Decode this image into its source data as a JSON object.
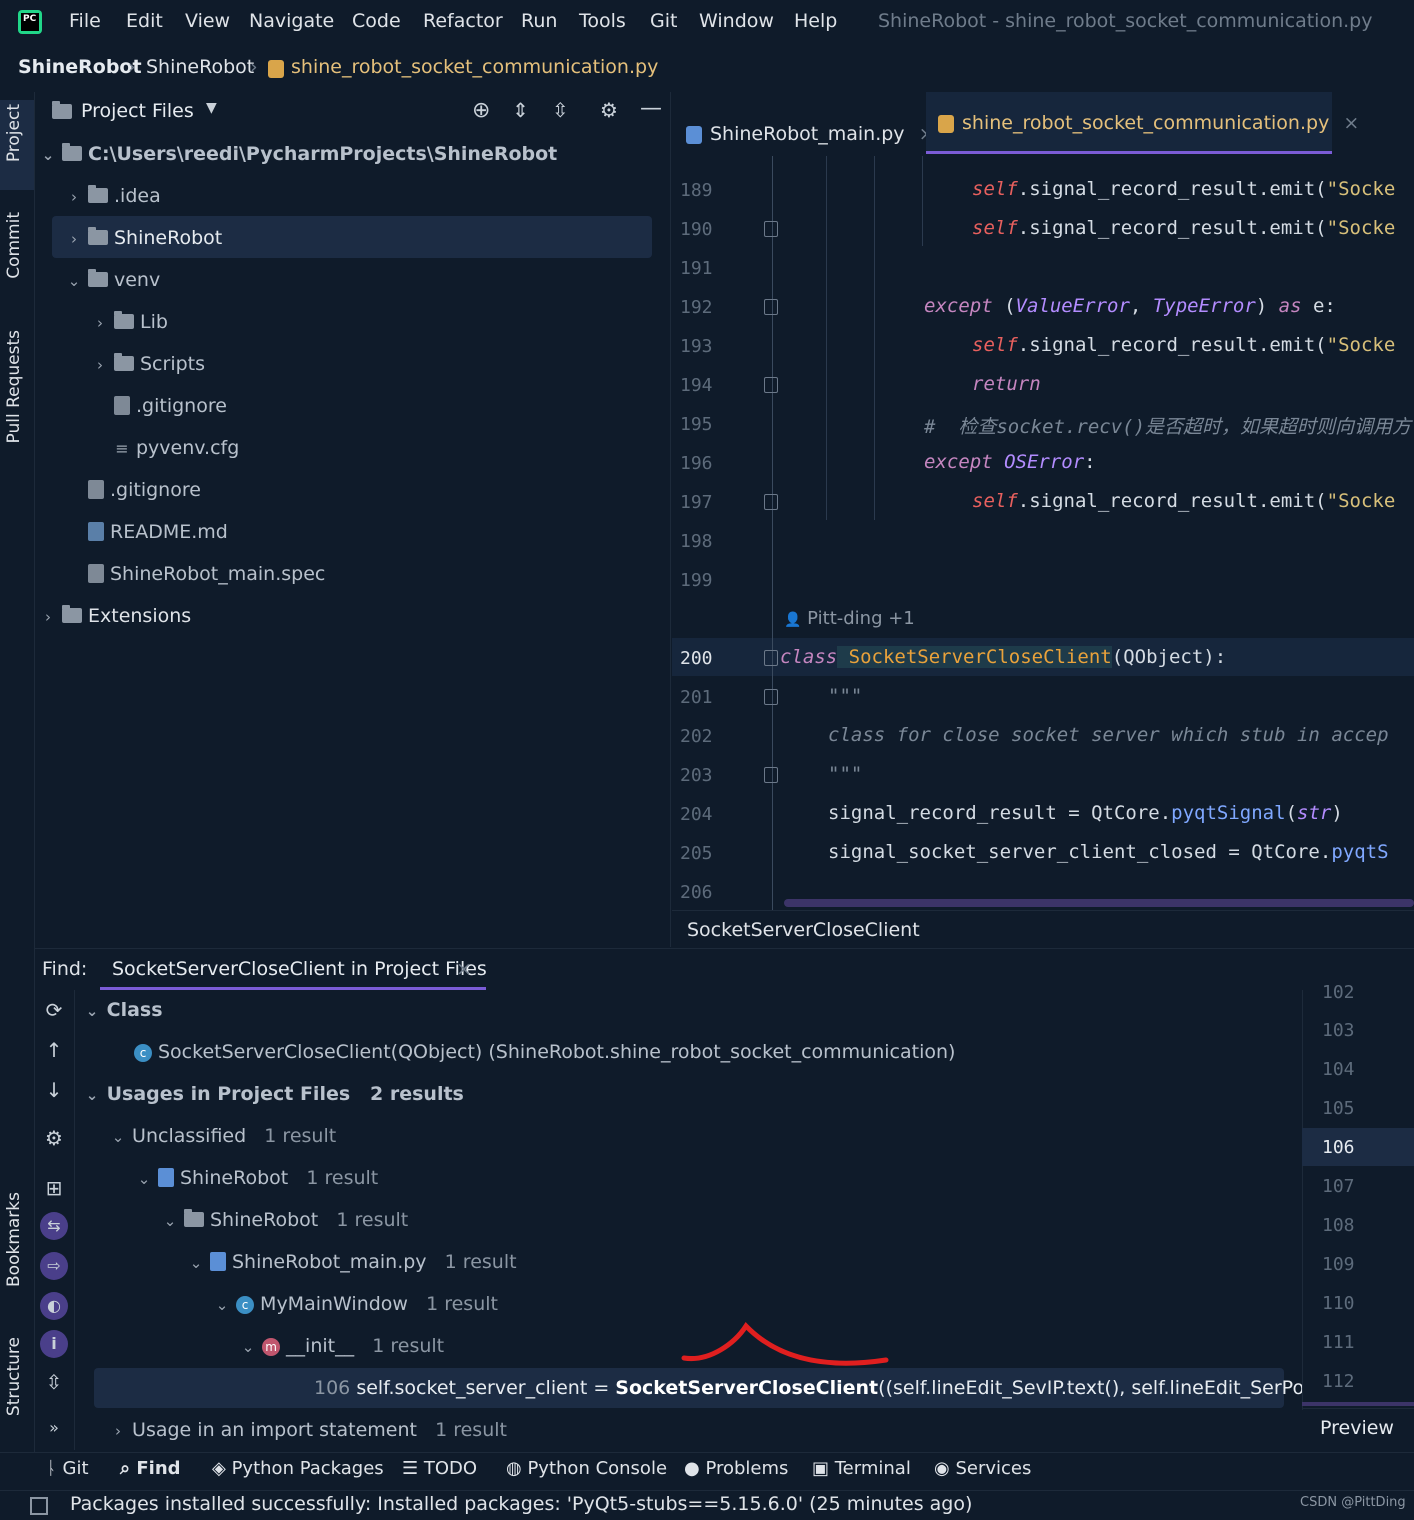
{
  "menubar": {
    "items": [
      "File",
      "Edit",
      "View",
      "Navigate",
      "Code",
      "Refactor",
      "Run",
      "Tools",
      "Git",
      "Window",
      "Help"
    ],
    "window_title": "ShineRobot - shine_robot_socket_communication.py"
  },
  "breadcrumb": [
    "ShineRobot",
    "ShineRobot",
    "shine_robot_socket_communication.py"
  ],
  "left_toolbar": [
    "Project",
    "Commit",
    "Pull Requests",
    "Bookmarks",
    "Structure"
  ],
  "project_panel": {
    "title": "Project Files",
    "tree": [
      {
        "label": "C:\\Users\\reedi\\PycharmProjects\\ShineRobot",
        "type": "folder"
      },
      {
        "label": ".idea",
        "type": "folder"
      },
      {
        "label": "ShineRobot",
        "type": "folder"
      },
      {
        "label": "venv",
        "type": "folder"
      },
      {
        "label": "Lib",
        "type": "folder"
      },
      {
        "label": "Scripts",
        "type": "folder"
      },
      {
        "label": ".gitignore",
        "type": "file"
      },
      {
        "label": "pyvenv.cfg",
        "type": "file"
      },
      {
        "label": ".gitignore",
        "type": "file"
      },
      {
        "label": "README.md",
        "type": "file"
      },
      {
        "label": "ShineRobot_main.spec",
        "type": "file"
      },
      {
        "label": "Extensions",
        "type": "folder"
      }
    ]
  },
  "editor": {
    "tabs": [
      "ShineRobot_main.py",
      "shine_robot_socket_communication.py"
    ],
    "line_numbers": [
      "189",
      "190",
      "191",
      "192",
      "193",
      "194",
      "195",
      "196",
      "197",
      "198",
      "199",
      "200",
      "201",
      "202",
      "203",
      "204",
      "205",
      "206"
    ],
    "lines": {
      "l189_self": "self",
      "l189_rest": ".signal_record_result.emit(",
      "l189_str": "\"Socke",
      "l190_self": "self",
      "l190_rest": ".signal_record_result.emit(",
      "l190_str": "\"Socke",
      "l192_kw": "except",
      "l192_p1": " (",
      "l192_e1": "ValueError",
      "l192_p2": ", ",
      "l192_e2": "TypeError",
      "l192_p3": ") ",
      "l192_as": "as",
      "l192_p4": " e:",
      "l193_self": "self",
      "l193_rest": ".signal_record_result.emit(",
      "l193_str": "\"Socke",
      "l194_kw": "return",
      "l195_cmt": "#  检查socket.recv()是否超时，如果超时则向调用方",
      "l196_kw": "except",
      "l196_exc": " OSError",
      "l196_p": ":",
      "l197_self": "self",
      "l197_rest": ".signal_record_result.emit(",
      "l197_str": "\"Socke",
      "author": "Pitt-ding +1",
      "l200_kw": "class",
      "l200_cls": " SocketServerCloseClient",
      "l200_rest": "(QObject):",
      "l201": "\"\"\"",
      "l202": "class for close socket server which stub in accep",
      "l203": "\"\"\"",
      "l204_a": "signal_record_result = QtCore.",
      "l204_m": "pyqtSignal",
      "l204_b": "(",
      "l204_t": "str",
      "l204_c": ")",
      "l205_a": "signal_socket_server_client_closed = QtCore.",
      "l205_m": "pyqtS"
    },
    "footer": "SocketServerCloseClient"
  },
  "find": {
    "label": "Find:",
    "tab": "SocketServerCloseClient in Project Files",
    "results": {
      "class_group": "Class",
      "class_item": "SocketServerCloseClient(QObject) (ShineRobot.shine_robot_socket_communication)",
      "usages_group": "Usages in Project Files",
      "usages_count": "2 results",
      "unclassified": "Unclassified",
      "unclassified_count": "1 result",
      "shinerobot1": "ShineRobot",
      "shinerobot1_count": "1 result",
      "shinerobot2": "ShineRobot",
      "shinerobot2_count": "1 result",
      "main_file": "ShineRobot_main.py",
      "main_file_count": "1 result",
      "mainwindow": "MyMainWindow",
      "mainwindow_count": "1 result",
      "init": "__init__",
      "init_count": "1 result",
      "usage_line": "106",
      "usage_pre": "self.socket_server_client = ",
      "usage_match": "SocketServerCloseClient",
      "usage_post": "((self.lineEdit_SevIP.text(), self.lineEdit_SerPort.text()))",
      "import_group": "Usage in an import statement",
      "import_count": "1 result"
    },
    "preview_lines": [
      "102",
      "103",
      "104",
      "105",
      "106",
      "107",
      "108",
      "109",
      "110",
      "111",
      "112"
    ],
    "preview_label": "Preview"
  },
  "bottom_tabs": [
    "Git",
    "Find",
    "Python Packages",
    "TODO",
    "Python Console",
    "Problems",
    "Terminal",
    "Services"
  ],
  "status": "Packages installed successfully: Installed packages: 'PyQt5-stubs==5.15.6.0' (25 minutes ago)",
  "watermark": "CSDN @PittDing",
  "colors": {
    "background": "#0f1b2a",
    "accent": "#7b5cd6",
    "annotation": "#e01f1f"
  }
}
